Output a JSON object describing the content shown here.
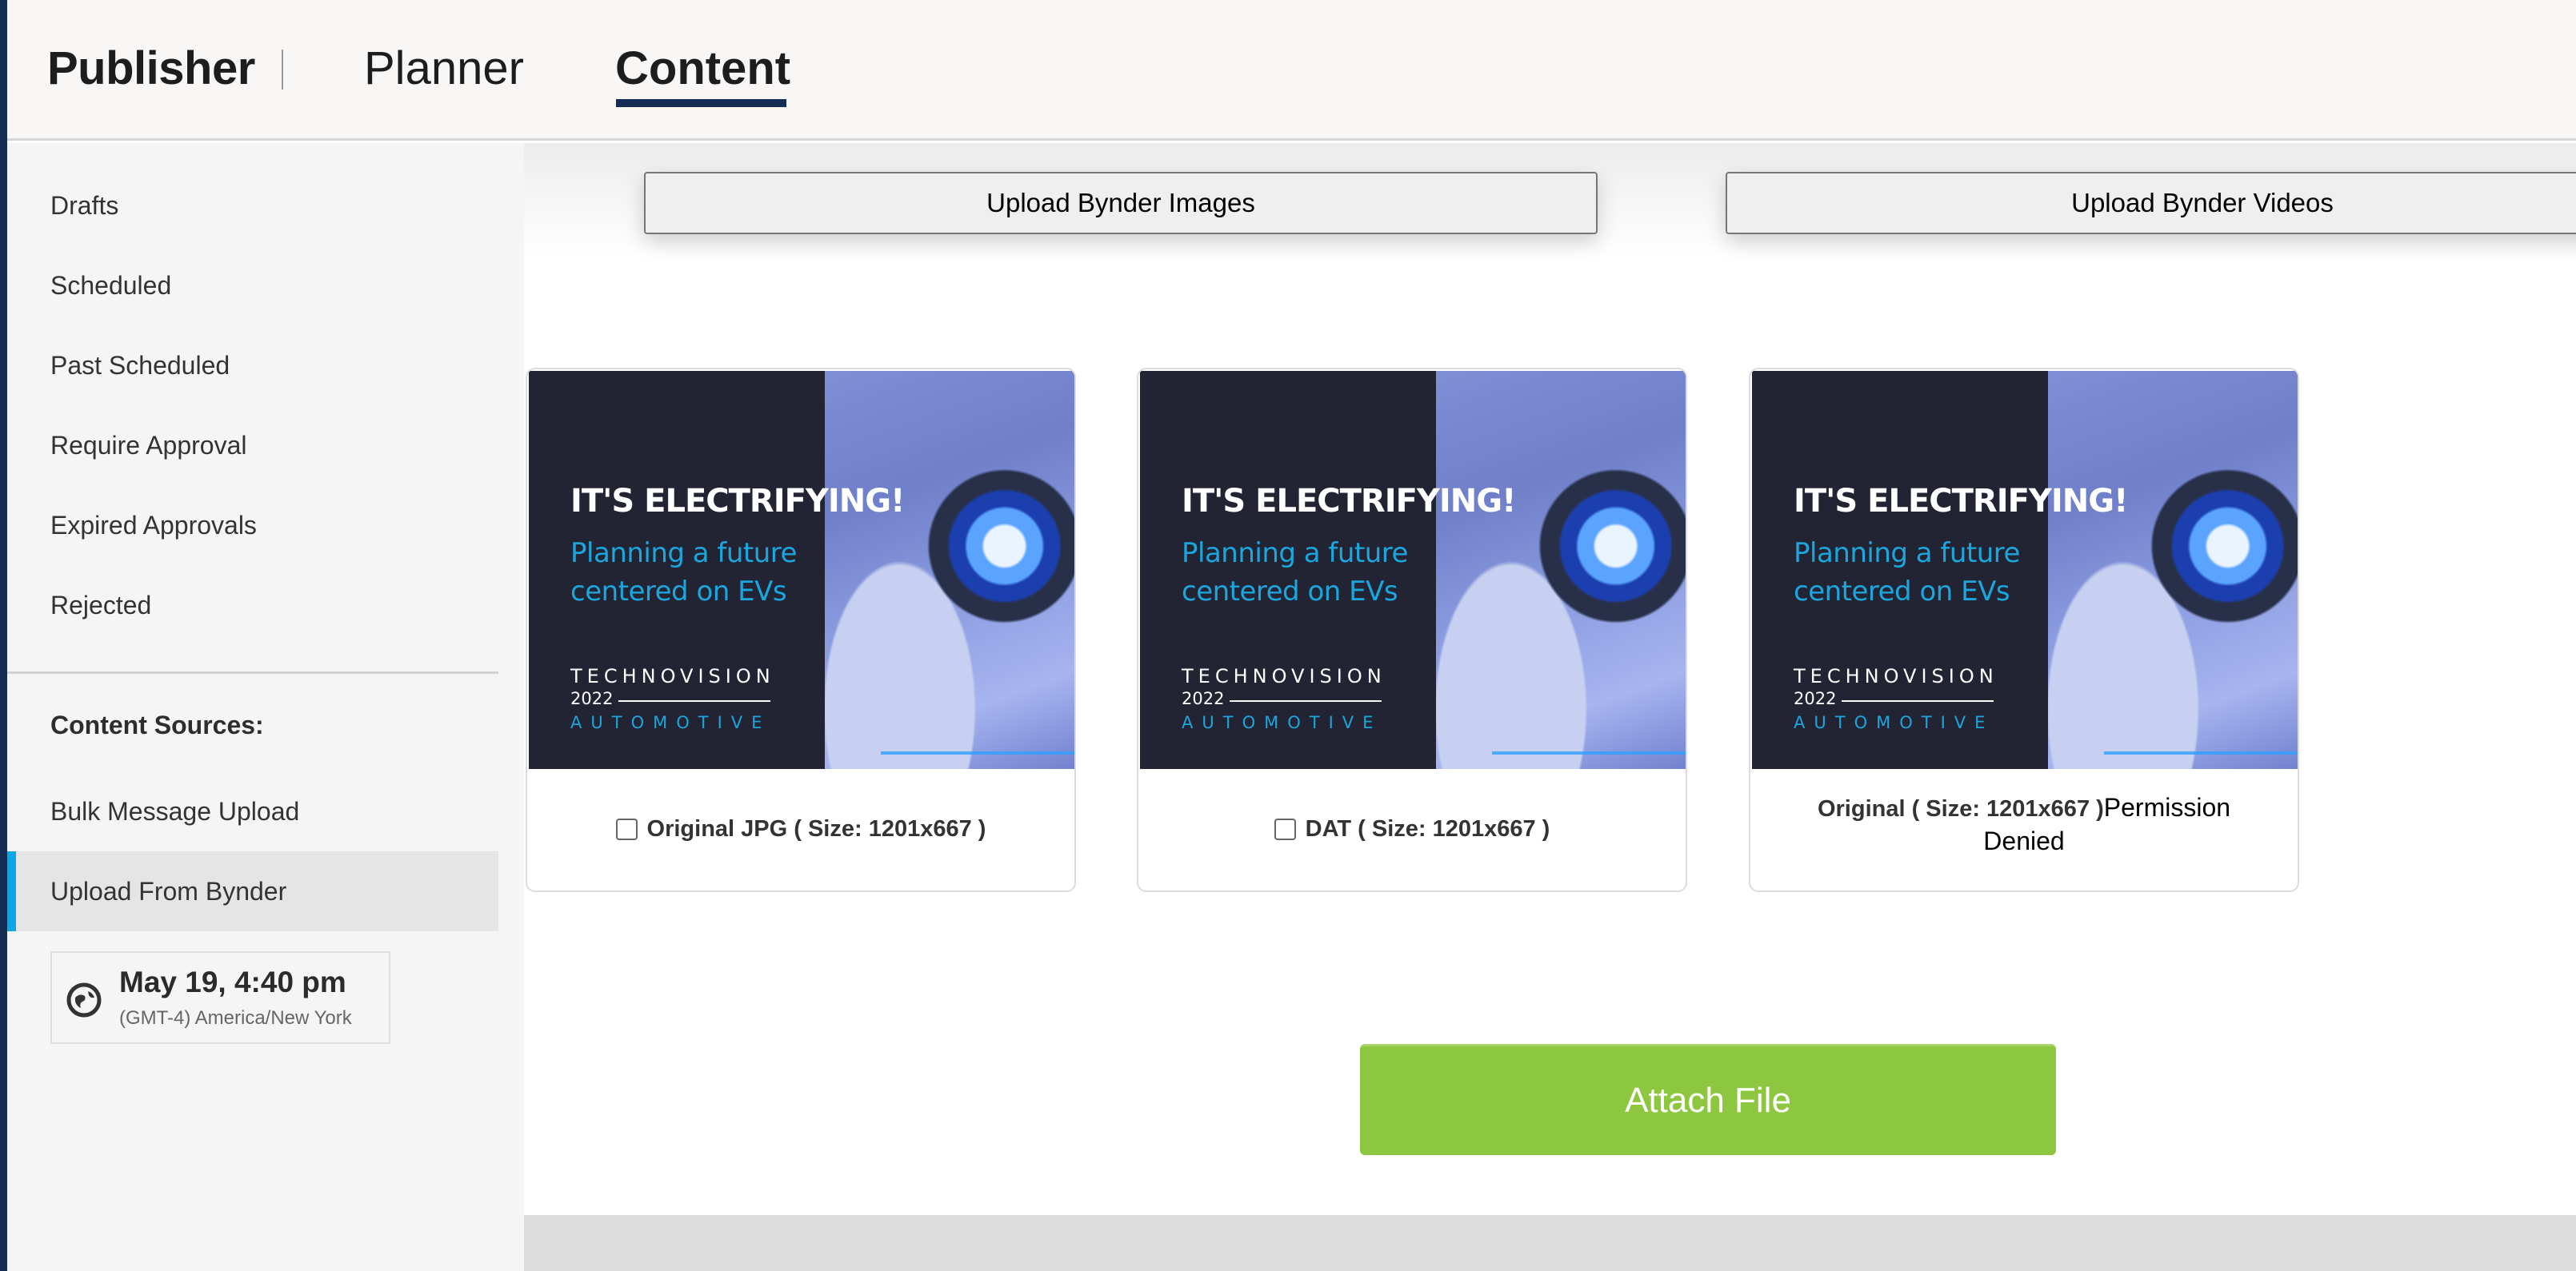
{
  "header": {
    "brand": "Publisher",
    "tabs": [
      {
        "label": "Planner",
        "active": false
      },
      {
        "label": "Content",
        "active": true
      }
    ]
  },
  "sidebar": {
    "items": [
      {
        "label": "Drafts"
      },
      {
        "label": "Scheduled"
      },
      {
        "label": "Past Scheduled"
      },
      {
        "label": "Require Approval"
      },
      {
        "label": "Expired Approvals"
      },
      {
        "label": "Rejected"
      }
    ],
    "sources_heading": "Content Sources:",
    "sources": [
      {
        "label": "Bulk Message Upload",
        "active": false
      },
      {
        "label": "Upload From Bynder",
        "active": true
      }
    ],
    "timezone": {
      "icon": "globe-icon",
      "time": "May 19, 4:40 pm",
      "zone": "(GMT-4) America/New York"
    }
  },
  "main": {
    "upload_images_label": "Upload Bynder Images",
    "upload_videos_label": "Upload Bynder Videos",
    "thumbnail": {
      "title": "IT'S ELECTRIFYING!",
      "subtitle": "Planning a future centered on EVs",
      "brand": "TECHNOVISION",
      "year": "2022",
      "category": "AUTOMOTIVE"
    },
    "cards": [
      {
        "caption": "Original JPG ( Size: 1201x667 )",
        "checkbox": true,
        "checked": false
      },
      {
        "caption": "DAT ( Size: 1201x667 )",
        "checkbox": true,
        "checked": false
      },
      {
        "caption": "Original ( Size: 1201x667 )",
        "note": "Permission Denied",
        "checkbox": false
      }
    ],
    "attach_label": "Attach File"
  },
  "colors": {
    "nav_accent": "#142d55",
    "active_indicator": "#0aa7e6",
    "attach_button": "#8dc63f"
  }
}
